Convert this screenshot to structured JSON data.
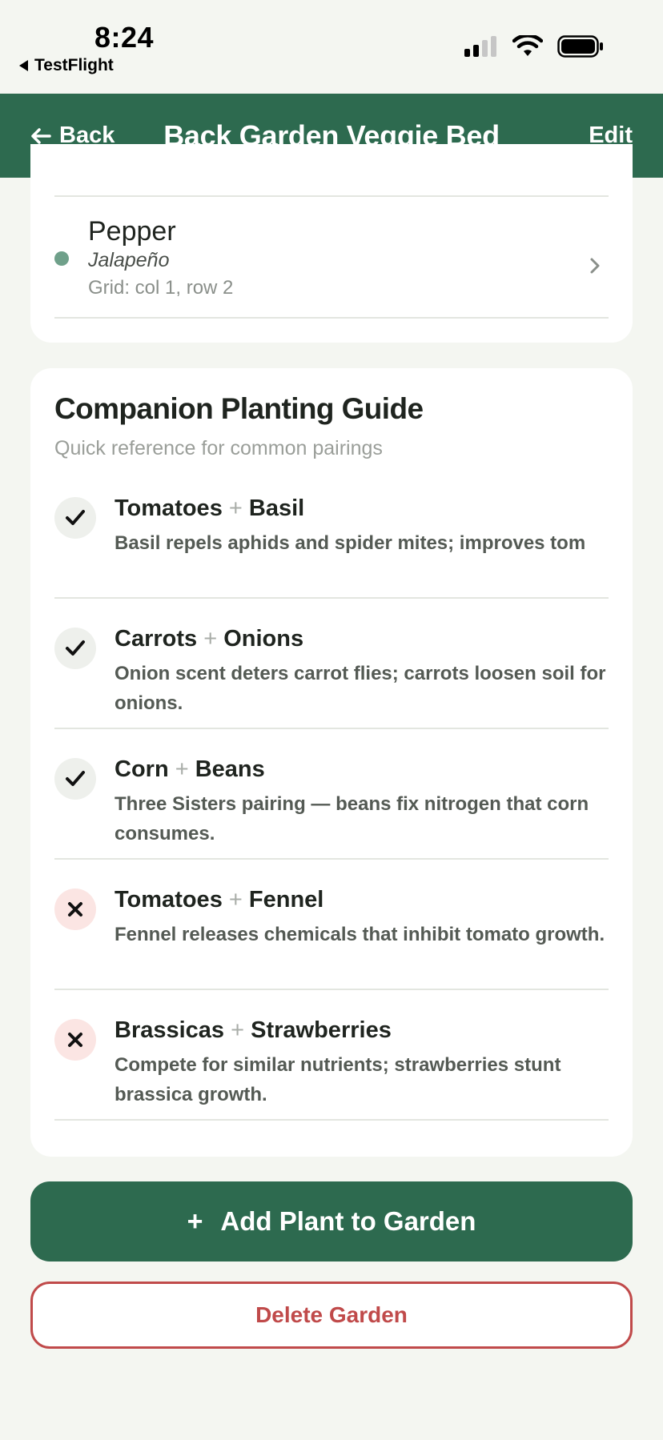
{
  "status_bar": {
    "time": "8:24",
    "back_app": "TestFlight"
  },
  "nav": {
    "back_label": "Back",
    "title": "Back Garden Veggie Bed",
    "edit_label": "Edit"
  },
  "plant": {
    "name": "Pepper",
    "variety": "Jalapeño",
    "grid": "Grid: col 1, row 2",
    "dot_color": "#6fa08a"
  },
  "guide": {
    "title": "Companion Planting Guide",
    "subtitle": "Quick reference for common pairings",
    "pairs": [
      {
        "a": "Tomatoes",
        "plus": "+",
        "b": "Basil",
        "good": true,
        "desc": "Basil repels aphids and spider mites; improves tom"
      },
      {
        "a": "Carrots",
        "plus": "+",
        "b": "Onions",
        "good": true,
        "desc": "Onion scent deters carrot flies; carrots loosen soil for onions."
      },
      {
        "a": "Corn",
        "plus": "+",
        "b": "Beans",
        "good": true,
        "desc": "Three Sisters pairing — beans fix nitrogen that corn consumes."
      },
      {
        "a": "Tomatoes",
        "plus": "+",
        "b": "Fennel",
        "good": false,
        "desc": "Fennel releases chemicals that inhibit tomato growth."
      },
      {
        "a": "Brassicas",
        "plus": "+",
        "b": "Strawberries",
        "good": false,
        "desc": "Compete for similar nutrients; strawberries stunt brassica growth."
      }
    ]
  },
  "actions": {
    "add_icon": "+",
    "add_label": "Add Plant to Garden",
    "delete_label": "Delete Garden"
  },
  "colors": {
    "brand": "#2d6a4f",
    "danger": "#c04a4a"
  }
}
